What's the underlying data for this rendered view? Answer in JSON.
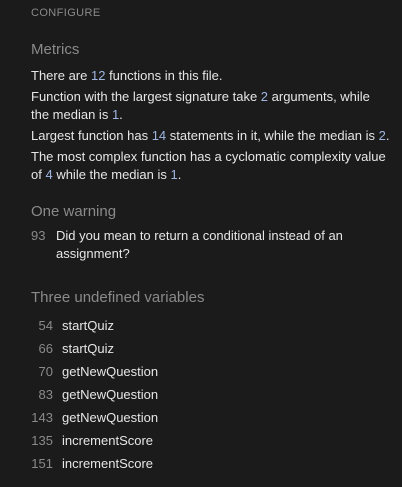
{
  "header": {
    "configure_label": "CONFIGURE"
  },
  "metrics": {
    "title": "Metrics",
    "functions_prefix": "There are ",
    "functions_count": "12",
    "functions_suffix": " functions in this file.",
    "sig_prefix": "Function with the largest signature take ",
    "sig_max": "2",
    "sig_middle": " arguments, while the median is ",
    "sig_median": "1",
    "sig_suffix": ".",
    "stmt_prefix": "Largest function has ",
    "stmt_max": "14",
    "stmt_middle": " statements in it, while the median is ",
    "stmt_median": "2",
    "stmt_suffix": ".",
    "cc_prefix": "The most complex function has a cyclomatic complexity value of ",
    "cc_max": "4",
    "cc_middle": " while the median is ",
    "cc_median": "1",
    "cc_suffix": "."
  },
  "warnings": {
    "title": "One warning",
    "items": [
      {
        "line": "93",
        "message": "Did you mean to return a conditional instead of an assignment?"
      }
    ]
  },
  "undefined": {
    "title": "Three undefined variables",
    "items": [
      {
        "line": "54",
        "name": "startQuiz"
      },
      {
        "line": "66",
        "name": "startQuiz"
      },
      {
        "line": "70",
        "name": "getNewQuestion"
      },
      {
        "line": "83",
        "name": "getNewQuestion"
      },
      {
        "line": "143",
        "name": "getNewQuestion"
      },
      {
        "line": "135",
        "name": "incrementScore"
      },
      {
        "line": "151",
        "name": "incrementScore"
      }
    ]
  }
}
